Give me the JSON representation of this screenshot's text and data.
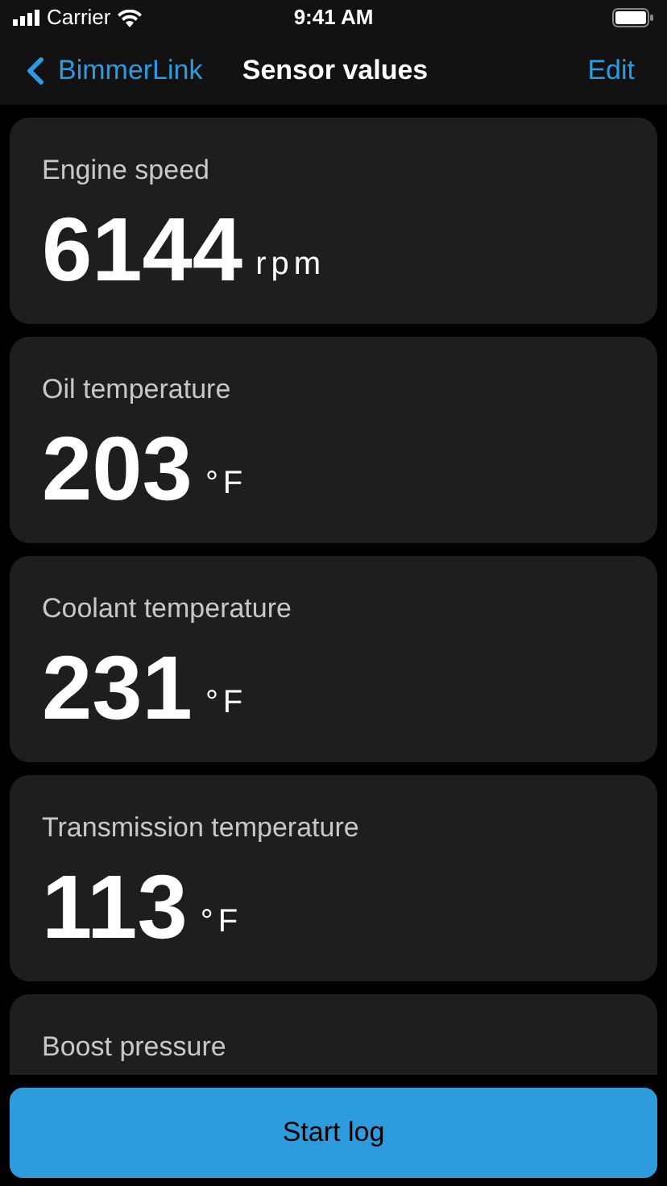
{
  "status_bar": {
    "carrier": "Carrier",
    "time": "9:41 AM"
  },
  "nav": {
    "back": "BimmerLink",
    "title": "Sensor values",
    "action": "Edit"
  },
  "sensors": [
    {
      "label": "Engine speed",
      "value": "6144",
      "unit": "rpm"
    },
    {
      "label": "Oil temperature",
      "value": "203",
      "unit": "°F"
    },
    {
      "label": "Coolant temperature",
      "value": "231",
      "unit": "°F"
    },
    {
      "label": "Transmission temperature",
      "value": "113",
      "unit": "°F"
    },
    {
      "label": "Boost pressure"
    }
  ],
  "button": "Start log"
}
